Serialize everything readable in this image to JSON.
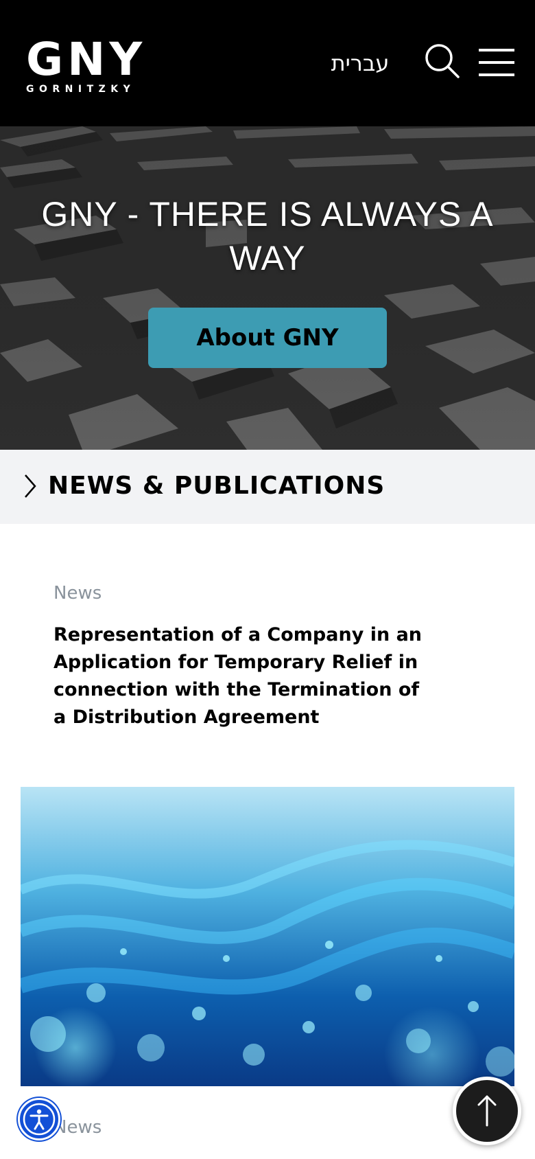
{
  "header": {
    "logo_main": "GNY",
    "logo_sub": "GORNITZKY",
    "language_label": "עברית",
    "search_icon": "search-icon",
    "menu_icon": "hamburger-menu-icon",
    "background_color": "#000000"
  },
  "hero": {
    "title": "GNY - THERE IS ALWAYS A WAY",
    "button_label": "About GNY",
    "button_color": "#3d9cb3"
  },
  "news_section": {
    "heading": "NEWS & PUBLICATIONS",
    "chevron_icon": "chevron-right-icon",
    "background_color": "#f2f3f5"
  },
  "articles": [
    {
      "category": "News",
      "title": "Representation of a Company in an Application for Temporary Relief in connection with the Termination of a Distribution Agreement"
    },
    {
      "category": "News"
    }
  ],
  "floating": {
    "accessibility_icon": "accessibility-icon",
    "accessibility_color": "#1350d6",
    "back_to_top_icon": "arrow-up-icon"
  }
}
